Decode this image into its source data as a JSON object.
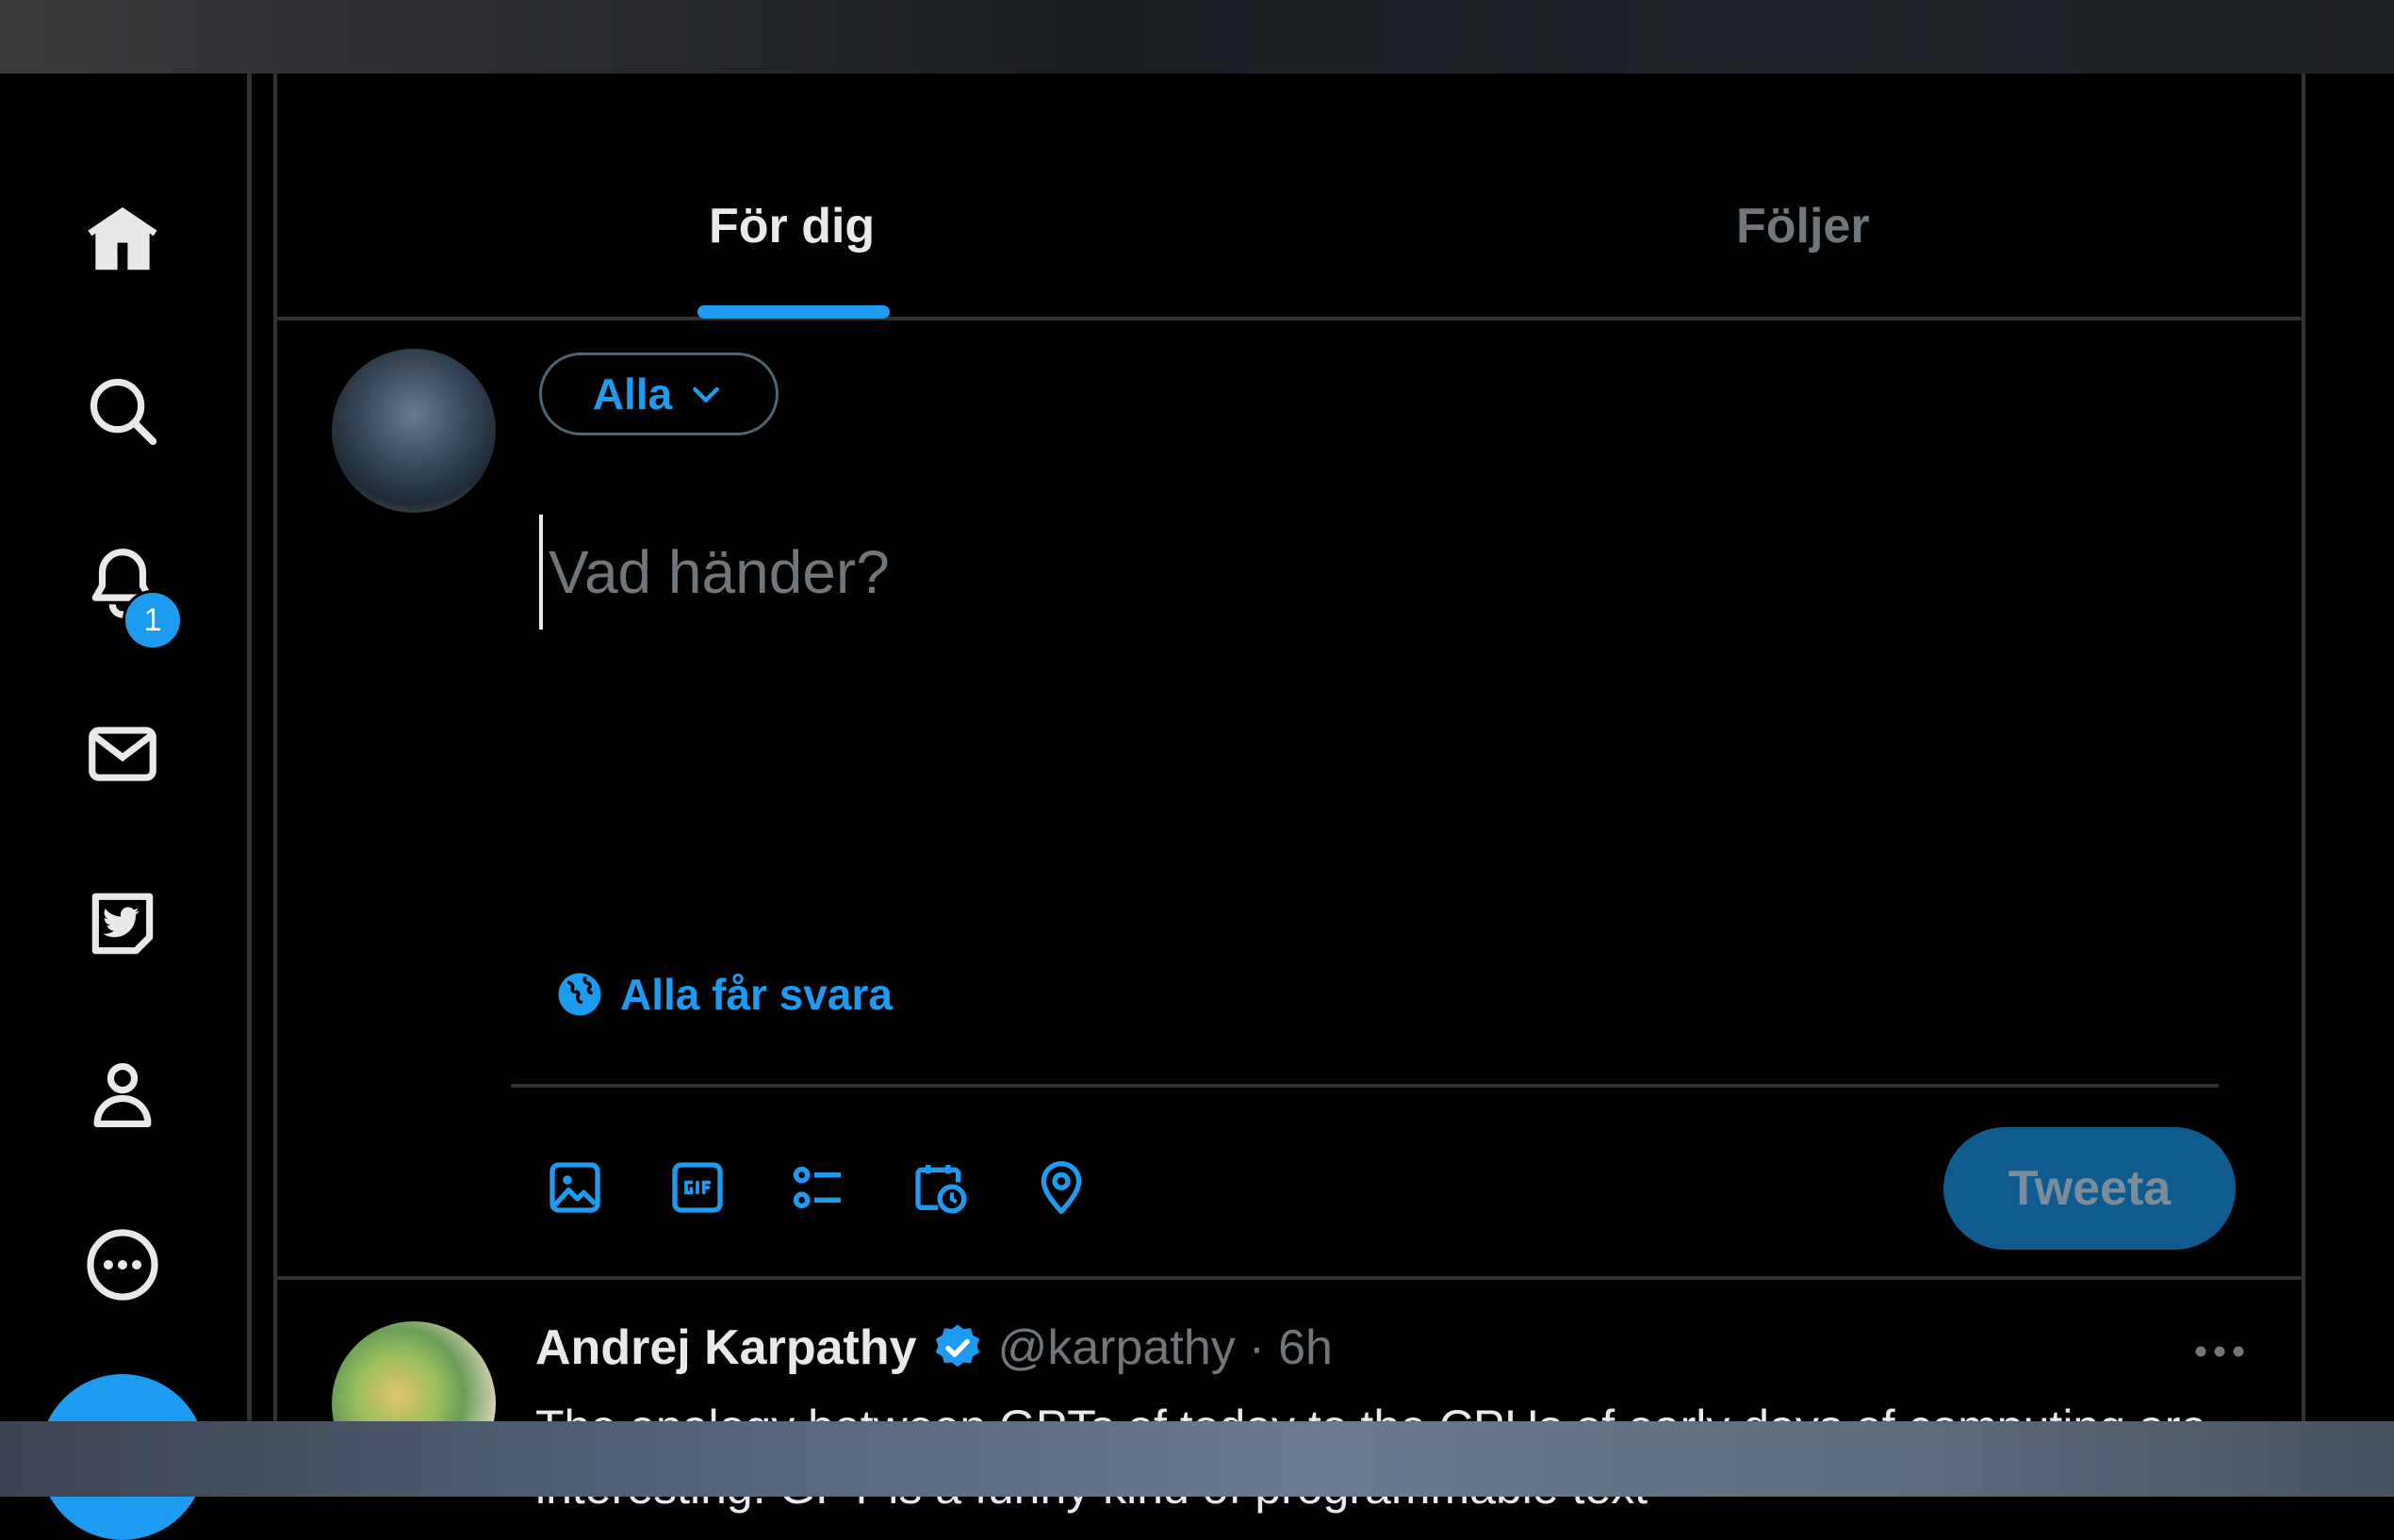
{
  "tabs": {
    "for_you": "För dig",
    "following": "Följer"
  },
  "nav": {
    "notification_badge": "1"
  },
  "composer": {
    "audience_label": "Alla",
    "placeholder": "Vad händer?",
    "reply_setting": "Alla får svara",
    "tweet_button": "Tweeta"
  },
  "post": {
    "author_name": "Andrej Karpathy",
    "handle": "@karpathy",
    "separator": "·",
    "time": "6h",
    "text": "The analogy between GPTs of today to the CPUs of early days of computing are interesting. GPT is a funny kind of programmable text"
  },
  "colors": {
    "accent": "#1d9bf0",
    "background": "#000000",
    "border": "#2f3336",
    "muted_text": "#71767b"
  },
  "icons": [
    "home-icon",
    "search-icon",
    "bell-icon",
    "mail-icon",
    "twitter-blue-icon",
    "profile-icon",
    "more-circle-icon",
    "image-icon",
    "gif-icon",
    "poll-icon",
    "schedule-icon",
    "location-icon",
    "globe-icon",
    "verified-icon",
    "chevron-down-icon",
    "ellipsis-icon"
  ]
}
